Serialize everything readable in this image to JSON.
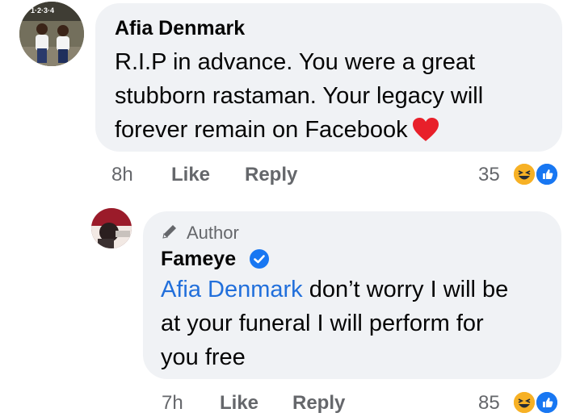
{
  "comment": {
    "author": "Afia Denmark",
    "lines": [
      "R.I.P in advance. You were a great",
      "stubborn rastaman. Your legacy will",
      "forever remain on Facebook"
    ],
    "time": "8h",
    "like_label": "Like",
    "reply_label": "Reply",
    "reaction_count": "35",
    "avatar_badge": "1·2·3·4"
  },
  "reply": {
    "badge": "Author",
    "author": "Fameye",
    "mention": "Afia Denmark",
    "line1_rest": " don’t worry I will be",
    "line2": "at your funeral I will perform for",
    "line3": "you free",
    "time": "7h",
    "like_label": "Like",
    "reply_label": "Reply",
    "reaction_count": "85"
  },
  "colors": {
    "bubble": "#f0f2f5",
    "link": "#216fdb",
    "meta": "#65676b",
    "heart": "#e8202a",
    "verified": "#1877f2"
  },
  "icons": [
    "heart-icon",
    "pencil-icon",
    "verified-badge-icon",
    "haha-reaction-icon",
    "like-reaction-icon"
  ]
}
